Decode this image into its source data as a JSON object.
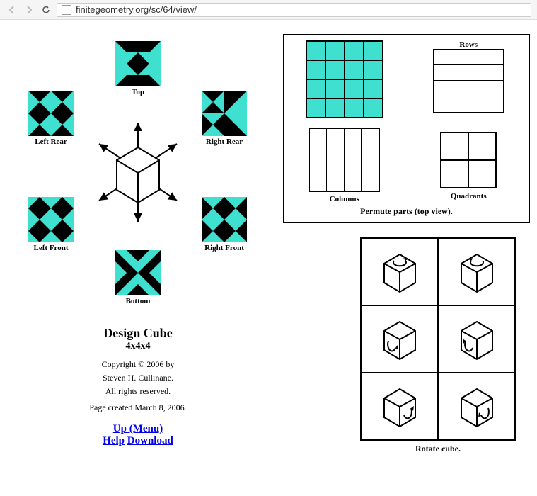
{
  "browser": {
    "url": "finitegeometry.org/sc/64/view/"
  },
  "faces": {
    "top": "Top",
    "left_rear": "Left Rear",
    "right_rear": "Right Rear",
    "left_front": "Left Front",
    "right_front": "Right Front",
    "bottom": "Bottom"
  },
  "info": {
    "title": "Design Cube",
    "subtitle": "4x4x4",
    "copyright_line1": "Copyright © 2006 by",
    "copyright_line2": "Steven H. Cullinane.",
    "copyright_line3": "All rights reserved.",
    "created": "Page created March 8, 2006."
  },
  "links": {
    "up": "Up (Menu)",
    "help": "Help",
    "download": "Download"
  },
  "permute": {
    "rows": "Rows",
    "columns": "Columns",
    "quadrants": "Quadrants",
    "caption": "Permute parts (top view)."
  },
  "rotate": {
    "caption": "Rotate cube."
  }
}
